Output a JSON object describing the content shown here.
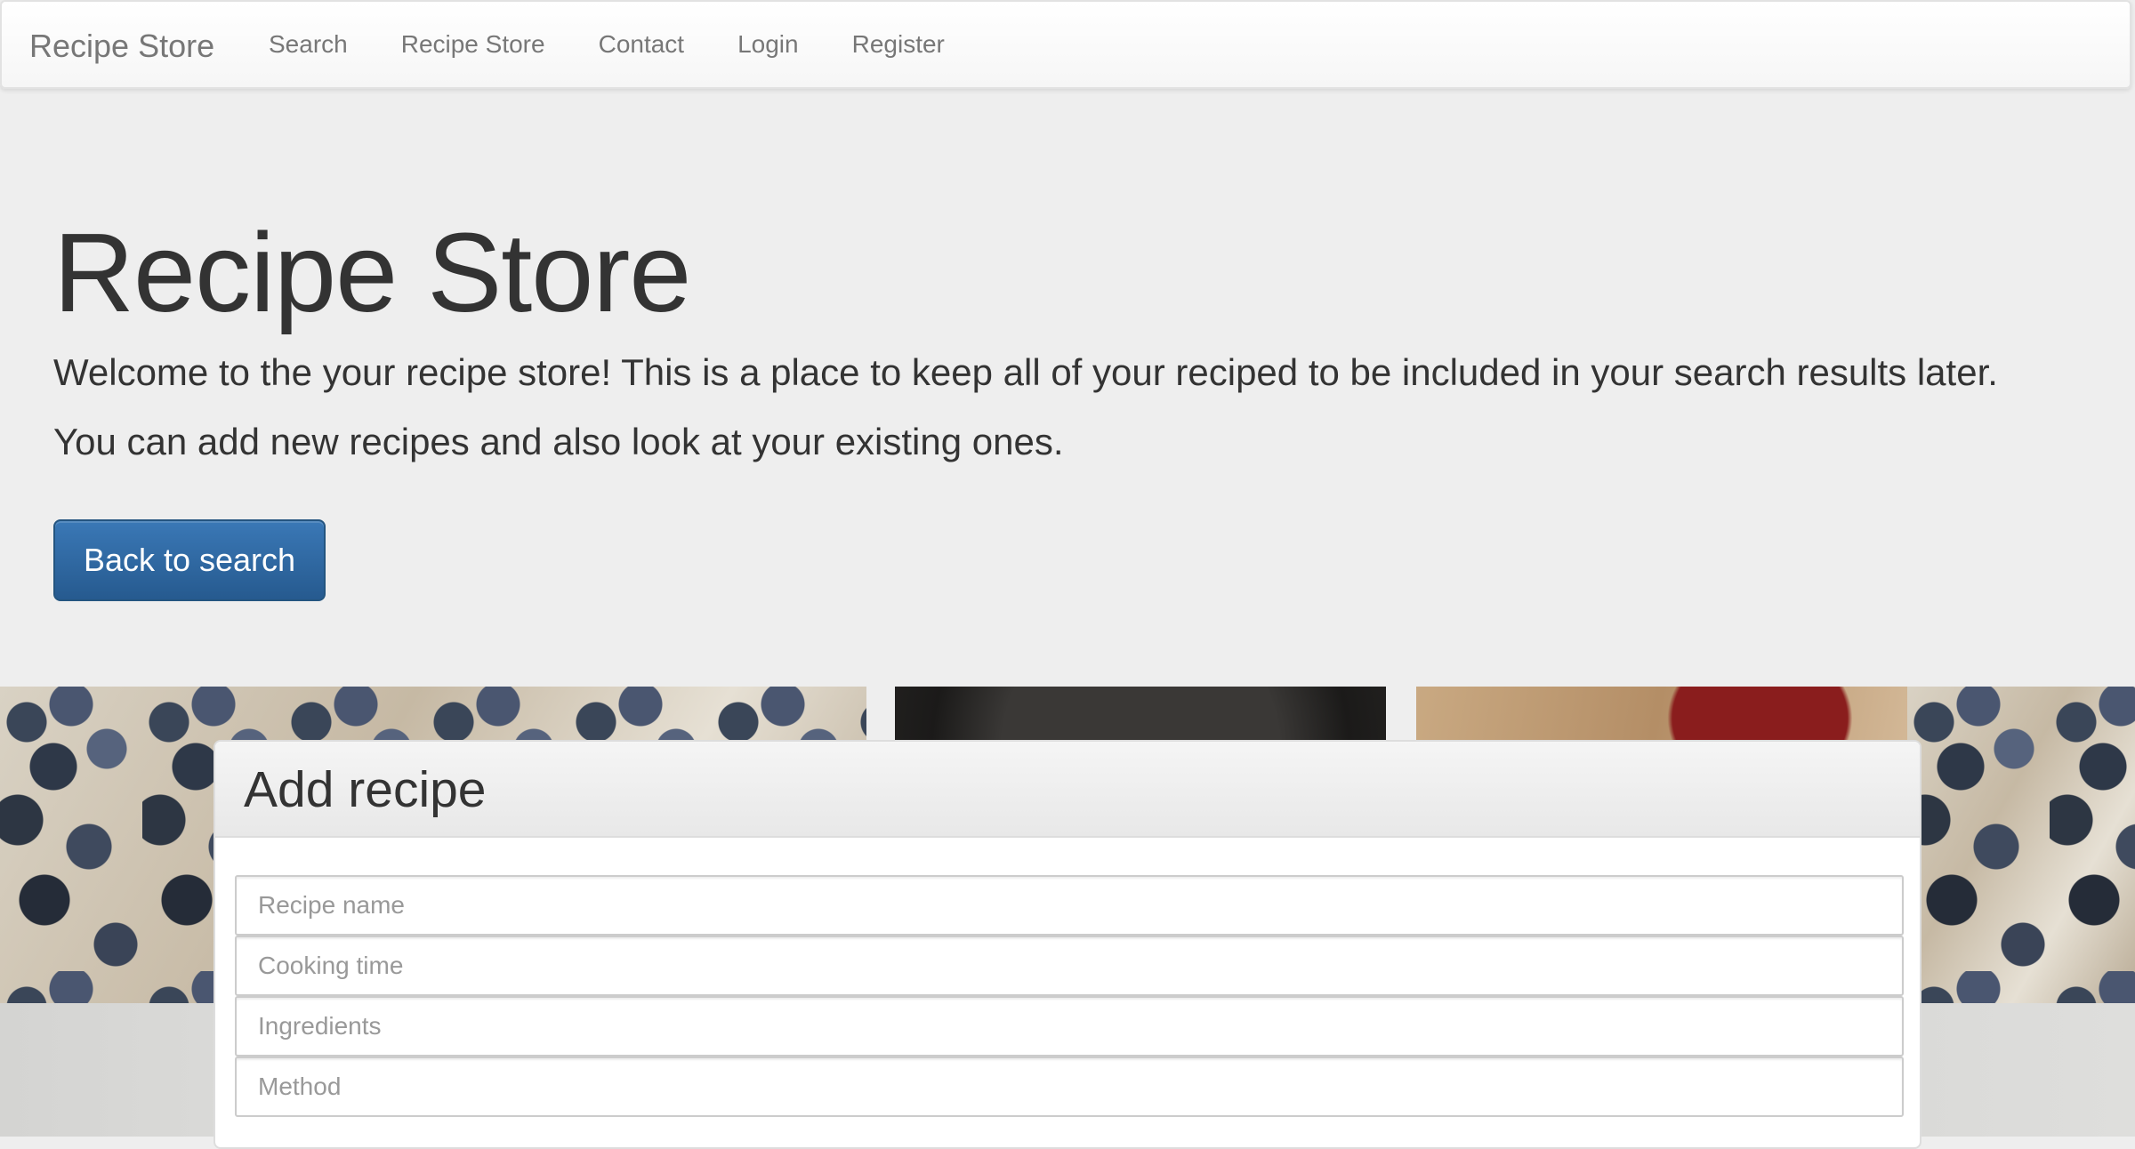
{
  "navbar": {
    "brand": "Recipe Store",
    "links": [
      "Search",
      "Recipe Store",
      "Contact",
      "Login",
      "Register"
    ]
  },
  "jumbotron": {
    "title": "Recipe Store",
    "line1": "Welcome to the your recipe store! This is a place to keep all of your reciped to be included in your search results later.",
    "line2": "You can add new recipes and also look at your existing ones.",
    "button": "Back to search"
  },
  "panel": {
    "title": "Add recipe",
    "fields": [
      {
        "placeholder": "Recipe name",
        "value": ""
      },
      {
        "placeholder": "Cooking time",
        "value": ""
      },
      {
        "placeholder": "Ingredients",
        "value": ""
      },
      {
        "placeholder": "Method",
        "value": ""
      }
    ]
  },
  "colors": {
    "page_bg": "#eeeeee",
    "primary": "#337ab7",
    "text": "#333333",
    "nav_text": "#777777"
  }
}
